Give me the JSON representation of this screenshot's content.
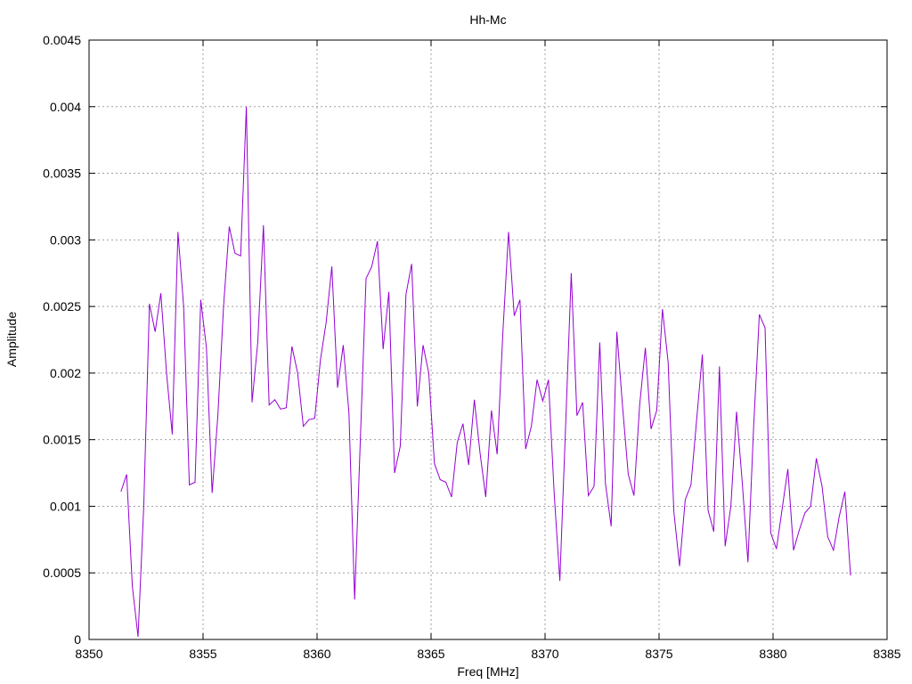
{
  "chart_data": {
    "type": "line",
    "title": "Hh-Mc",
    "xlabel": "Freq [MHz]",
    "ylabel": "Amplitude",
    "xlim": [
      8350,
      8385
    ],
    "ylim": [
      0,
      0.0045
    ],
    "xticks": [
      8350,
      8355,
      8360,
      8365,
      8370,
      8375,
      8380,
      8385
    ],
    "yticks": [
      0,
      0.0005,
      0.001,
      0.0015,
      0.002,
      0.0025,
      0.003,
      0.0035,
      0.004,
      0.0045
    ],
    "ytick_labels": [
      "0",
      "0.0005",
      "0.001",
      "0.0015",
      "0.002",
      "0.0025",
      "0.003",
      "0.0035",
      "0.004",
      "0.0045"
    ],
    "grid": true,
    "series": [
      {
        "color": "#9400d3",
        "x": [
          8351.4,
          8351.65,
          8351.9,
          8352.15,
          8352.4,
          8352.65,
          8352.9,
          8353.15,
          8353.4,
          8353.65,
          8353.9,
          8354.15,
          8354.4,
          8354.65,
          8354.9,
          8355.15,
          8355.4,
          8355.65,
          8355.9,
          8356.15,
          8356.4,
          8356.65,
          8356.9,
          8357.15,
          8357.4,
          8357.65,
          8357.9,
          8358.15,
          8358.4,
          8358.65,
          8358.9,
          8359.15,
          8359.4,
          8359.65,
          8359.9,
          8360.15,
          8360.4,
          8360.65,
          8360.9,
          8361.15,
          8361.4,
          8361.65,
          8361.9,
          8362.15,
          8362.4,
          8362.65,
          8362.9,
          8363.15,
          8363.4,
          8363.65,
          8363.9,
          8364.15,
          8364.4,
          8364.65,
          8364.9,
          8365.15,
          8365.4,
          8365.65,
          8365.9,
          8366.15,
          8366.4,
          8366.65,
          8366.9,
          8367.15,
          8367.4,
          8367.65,
          8367.9,
          8368.15,
          8368.4,
          8368.65,
          8368.9,
          8369.15,
          8369.4,
          8369.65,
          8369.9,
          8370.15,
          8370.4,
          8370.65,
          8370.9,
          8371.15,
          8371.4,
          8371.65,
          8371.9,
          8372.15,
          8372.4,
          8372.65,
          8372.9,
          8373.15,
          8373.4,
          8373.65,
          8373.9,
          8374.15,
          8374.4,
          8374.65,
          8374.9,
          8375.15,
          8375.4,
          8375.65,
          8375.9,
          8376.15,
          8376.4,
          8376.65,
          8376.9,
          8377.15,
          8377.4,
          8377.65,
          8377.9,
          8378.15,
          8378.4,
          8378.65,
          8378.9,
          8379.15,
          8379.4,
          8379.65,
          8379.9,
          8380.15,
          8380.4,
          8380.65,
          8380.9,
          8381.15,
          8381.4,
          8381.65,
          8381.9,
          8382.15,
          8382.4,
          8382.65,
          8382.9,
          8383.15,
          8383.4
        ],
        "y": [
          0.00111,
          0.00124,
          0.0004,
          2e-05,
          0.001,
          0.00252,
          0.00231,
          0.0026,
          0.002,
          0.00154,
          0.00306,
          0.0025,
          0.00116,
          0.00118,
          0.00255,
          0.00219,
          0.0011,
          0.00168,
          0.0025,
          0.0031,
          0.0029,
          0.00288,
          0.004,
          0.00178,
          0.00223,
          0.00311,
          0.00176,
          0.0018,
          0.00173,
          0.00174,
          0.0022,
          0.002,
          0.0016,
          0.00165,
          0.00166,
          0.0021,
          0.00238,
          0.0028,
          0.00189,
          0.00221,
          0.0017,
          0.0003,
          0.0015,
          0.00271,
          0.0028,
          0.00299,
          0.00218,
          0.00261,
          0.00125,
          0.00145,
          0.00259,
          0.00282,
          0.00175,
          0.00221,
          0.002,
          0.00132,
          0.0012,
          0.00118,
          0.00107,
          0.00148,
          0.00162,
          0.00131,
          0.0018,
          0.0014,
          0.00107,
          0.00172,
          0.00139,
          0.0023,
          0.00306,
          0.00243,
          0.00255,
          0.00143,
          0.0016,
          0.00195,
          0.00179,
          0.00195,
          0.0011,
          0.00044,
          0.00159,
          0.00275,
          0.00168,
          0.00178,
          0.00108,
          0.00115,
          0.00223,
          0.00117,
          0.00085,
          0.00231,
          0.00175,
          0.00124,
          0.00108,
          0.00176,
          0.00219,
          0.00158,
          0.00172,
          0.00248,
          0.00208,
          0.00096,
          0.00055,
          0.00105,
          0.00116,
          0.00165,
          0.00214,
          0.00097,
          0.00081,
          0.00205,
          0.0007,
          0.001,
          0.00171,
          0.00118,
          0.00058,
          0.0016,
          0.00244,
          0.00234,
          0.0008,
          0.00068,
          0.00098,
          0.00128,
          0.00067,
          0.00082,
          0.00095,
          0.001,
          0.00136,
          0.00115,
          0.00077,
          0.00067,
          0.00092,
          0.00111,
          0.00048
        ]
      }
    ]
  }
}
